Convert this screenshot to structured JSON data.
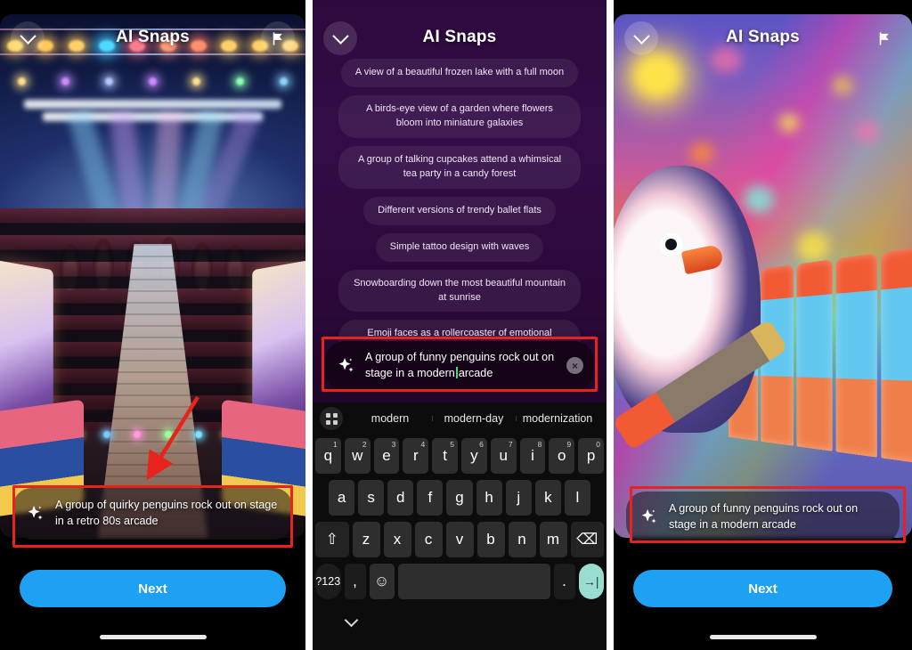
{
  "app": {
    "title": "AI Snaps",
    "accent_blue": "#1EA1F2",
    "annotation_red": "#E8221C",
    "caret_green": "#3DDC84",
    "enter_key_teal": "#9BDCD0"
  },
  "panel1": {
    "header": {
      "title": "AI Snaps",
      "back_icon": "chevron-down-icon",
      "flag_icon": "flag-icon"
    },
    "generated_image_alt": "A group of quirky penguins rock out on stage in a retro 80s arcade",
    "prompt": {
      "icon": "sparkle-icon",
      "text": "A group of quirky penguins rock out on stage in a retro 80s arcade"
    },
    "next_label": "Next"
  },
  "panel2": {
    "header": {
      "title": "AI Snaps",
      "back_icon": "chevron-down-icon"
    },
    "suggestion_chips": [
      "A view of a beautiful frozen lake with a full moon",
      "A birds-eye view of a garden where flowers bloom into miniature galaxies",
      "A group of talking cupcakes attend a whimsical tea party in a candy forest",
      "Different versions of trendy ballet flats",
      "Simple tattoo design with waves",
      "Snowboarding down the most beautiful mountain at sunrise",
      "Emoji faces as a rollercoaster of emotional rollercoasters"
    ],
    "input": {
      "icon": "sparkle-icon",
      "text_before_caret": "A group of funny penguins rock out on stage in a modern",
      "text_after_caret": "arcade",
      "full_value": "A group of funny penguins rock out on stage in a modern arcade",
      "clear_icon": "close-circle-icon",
      "clear_label": "×"
    },
    "keyboard": {
      "toolbar_icon": "grid-icon",
      "predictions": [
        "modern",
        "modern-day",
        "modernization"
      ],
      "row1": [
        {
          "key": "q",
          "num": "1"
        },
        {
          "key": "w",
          "num": "2"
        },
        {
          "key": "e",
          "num": "3"
        },
        {
          "key": "r",
          "num": "4"
        },
        {
          "key": "t",
          "num": "5"
        },
        {
          "key": "y",
          "num": "6"
        },
        {
          "key": "u",
          "num": "7"
        },
        {
          "key": "i",
          "num": "8"
        },
        {
          "key": "o",
          "num": "9"
        },
        {
          "key": "p",
          "num": "0"
        }
      ],
      "row2": [
        "a",
        "s",
        "d",
        "f",
        "g",
        "h",
        "j",
        "k",
        "l"
      ],
      "row3": [
        "z",
        "x",
        "c",
        "v",
        "b",
        "n",
        "m"
      ],
      "shift_label": "⇧",
      "backspace_label": "⌫",
      "symbols_label": "?123",
      "comma_label": ",",
      "emoji_label": "☺",
      "space_label": "",
      "period_label": ".",
      "enter_label": "→|",
      "dismiss_icon": "chevron-down-icon"
    }
  },
  "panel3": {
    "header": {
      "title": "AI Snaps",
      "back_icon": "chevron-down-icon",
      "flag_icon": "flag-icon"
    },
    "generated_image_alt": "A group of funny penguins rock out on stage in a modern arcade",
    "prompt": {
      "icon": "sparkle-icon",
      "text": "A group of funny penguins rock out on stage in a modern arcade"
    },
    "next_label": "Next"
  }
}
